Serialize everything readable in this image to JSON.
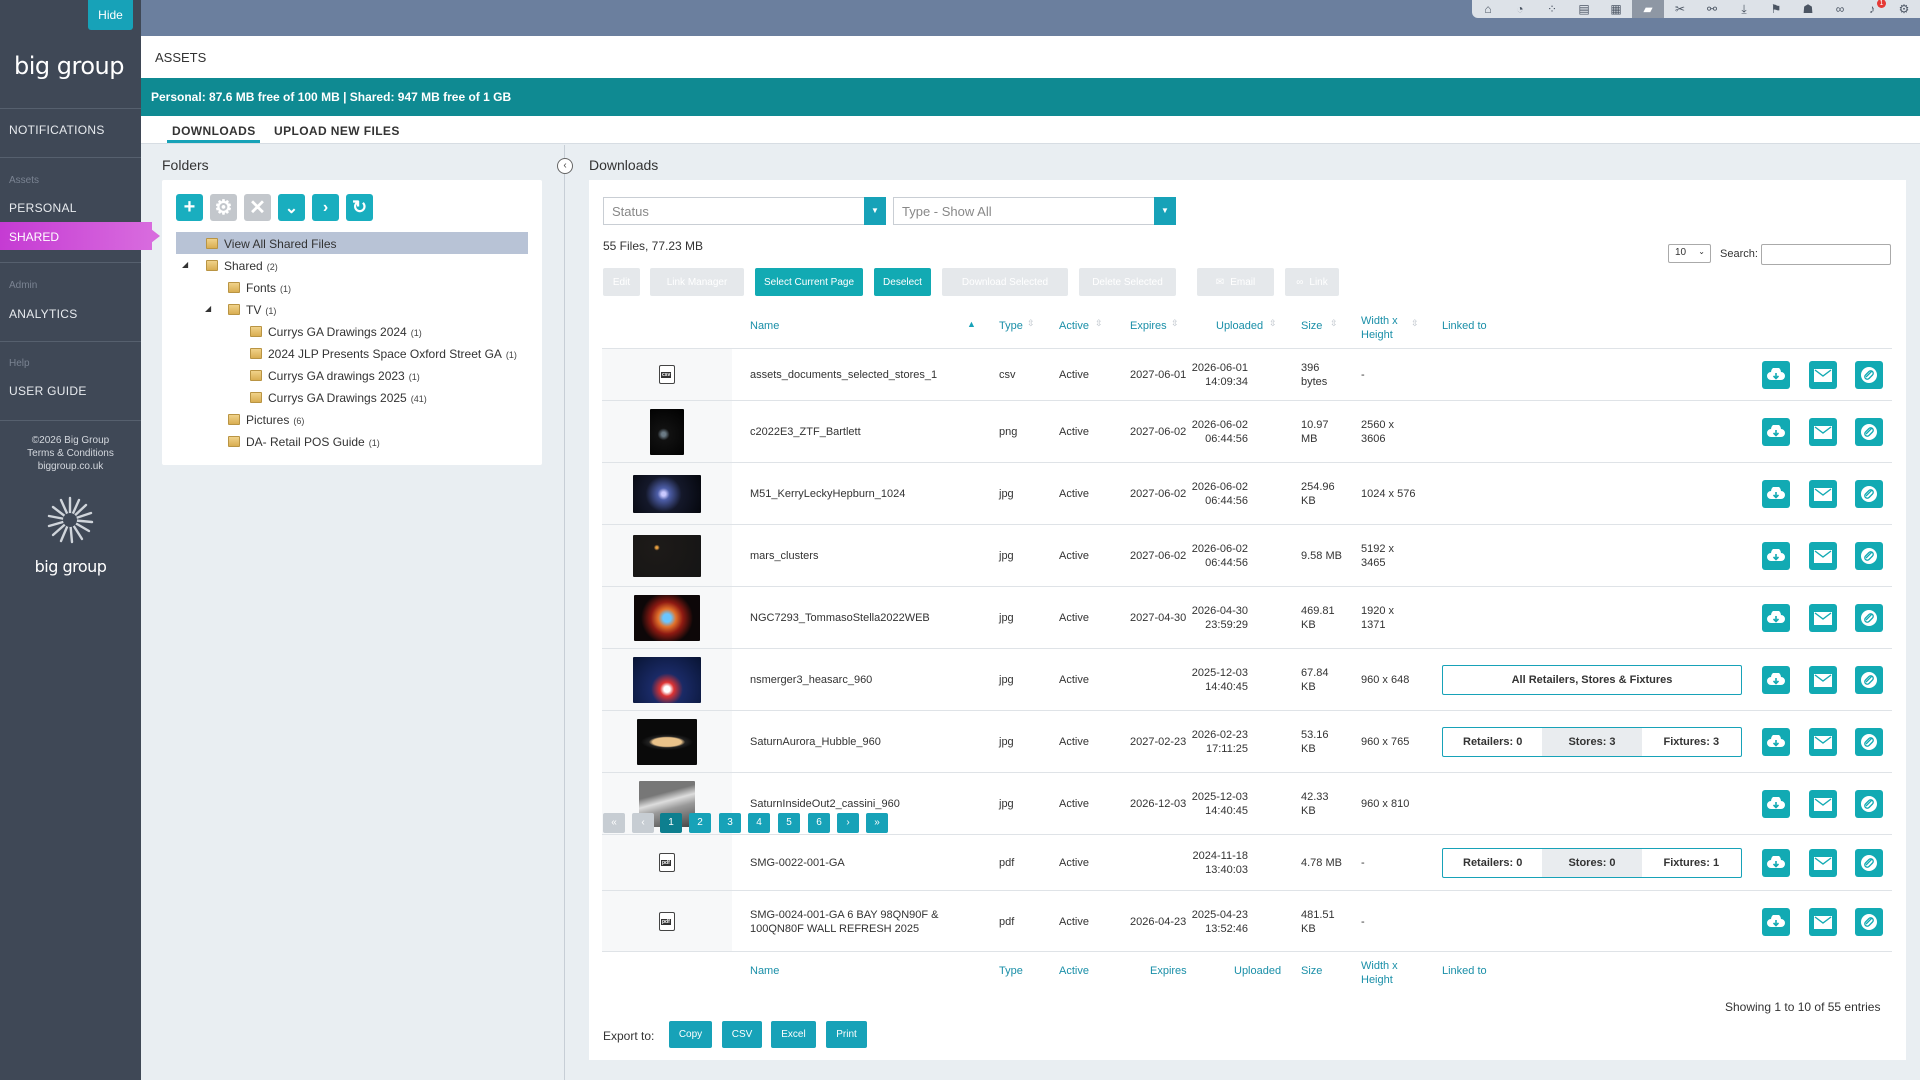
{
  "sidebar": {
    "hide_label": "Hide",
    "logo_text": "big group",
    "items": {
      "notifications": "NOTIFICATIONS",
      "assets_heading": "Assets",
      "personal": "PERSONAL",
      "shared": "SHARED",
      "admin_heading": "Admin",
      "analytics": "ANALYTICS",
      "help_heading": "Help",
      "user_guide": "USER GUIDE"
    },
    "copyright": [
      "©2026 Big Group",
      "Terms & Conditions",
      "biggroup.co.uk"
    ],
    "logo_bottom": "big group"
  },
  "topbar": {
    "icons": [
      "home-icon",
      "dashboard-icon",
      "network-icon",
      "document-icon",
      "grid-icon",
      "folder-icon",
      "tools-icon",
      "sitemap-icon",
      "download-icon",
      "megaphone-icon",
      "robot-icon",
      "link-icon",
      "bell-icon",
      "gear-icon"
    ],
    "active": "folder-icon",
    "notification_badge": "1"
  },
  "header": {
    "title": "ASSETS"
  },
  "quota": "Personal: 87.6 MB free of 100 MB | Shared: 947 MB free of 1 GB",
  "tabs": {
    "downloads": "DOWNLOADS",
    "upload": "UPLOAD NEW FILES"
  },
  "folders": {
    "title": "Folders",
    "tree": [
      {
        "label": "View All Shared Files",
        "count": ""
      },
      {
        "label": "Shared",
        "count": "(2)"
      },
      {
        "label": "Fonts",
        "count": "(1)"
      },
      {
        "label": "TV",
        "count": "(1)"
      },
      {
        "label": "Currys GA Drawings 2024",
        "count": "(1)"
      },
      {
        "label": "2024 JLP Presents Space Oxford Street GA",
        "count": "(1)"
      },
      {
        "label": "Currys GA drawings 2023",
        "count": "(1)"
      },
      {
        "label": "Currys GA Drawings 2025",
        "count": "(41)"
      },
      {
        "label": "Pictures",
        "count": "(6)"
      },
      {
        "label": "DA- Retail POS Guide",
        "count": "(1)"
      }
    ]
  },
  "downloads": {
    "title": "Downloads",
    "status_placeholder": "Status",
    "type_filter": "Type - Show All",
    "summary": "55 Files, 77.23 MB",
    "page_length": "10",
    "search_label": "Search:",
    "buttons": {
      "edit": "Edit",
      "link_manager": "Link Manager",
      "select_page": "Select Current Page",
      "deselect": "Deselect",
      "download_selected": "Download Selected",
      "delete_selected": "Delete Selected",
      "email": "Email",
      "link": "Link"
    },
    "columns": {
      "name": "Name",
      "type": "Type",
      "active": "Active",
      "expires": "Expires",
      "uploaded": "Uploaded",
      "size": "Size",
      "dims": "Width x Height",
      "linked": "Linked to"
    },
    "rows": [
      {
        "name": "assets_documents_selected_stores_1",
        "type": "csv",
        "active": "Active",
        "expires": "2027-06-01",
        "uploaded_date": "2026-06-01",
        "uploaded_time": "14:09:34",
        "size1": "396",
        "size2": "bytes",
        "dims1": "-",
        "dims2": ""
      },
      {
        "name": "c2022E3_ZTF_Bartlett",
        "type": "png",
        "active": "Active",
        "expires": "2027-06-02",
        "uploaded_date": "2026-06-02",
        "uploaded_time": "06:44:56",
        "size1": "10.97",
        "size2": "MB",
        "dims1": "2560 x",
        "dims2": "3606"
      },
      {
        "name": "M51_KerryLeckyHepburn_1024",
        "type": "jpg",
        "active": "Active",
        "expires": "2027-06-02",
        "uploaded_date": "2026-06-02",
        "uploaded_time": "06:44:56",
        "size1": "254.96",
        "size2": "KB",
        "dims1": "1024 x 576",
        "dims2": ""
      },
      {
        "name": "mars_clusters",
        "type": "jpg",
        "active": "Active",
        "expires": "2027-06-02",
        "uploaded_date": "2026-06-02",
        "uploaded_time": "06:44:56",
        "size1": "9.58 MB",
        "size2": "",
        "dims1": "5192 x",
        "dims2": "3465"
      },
      {
        "name": "NGC7293_TommasoStella2022WEB",
        "type": "jpg",
        "active": "Active",
        "expires": "2027-04-30",
        "uploaded_date": "2026-04-30",
        "uploaded_time": "23:59:29",
        "size1": "469.81",
        "size2": "KB",
        "dims1": "1920 x",
        "dims2": "1371"
      },
      {
        "name": "nsmerger3_heasarc_960",
        "type": "jpg",
        "active": "Active",
        "expires": "",
        "uploaded_date": "2025-12-03",
        "uploaded_time": "14:40:45",
        "size1": "67.84",
        "size2": "KB",
        "dims1": "960 x 648",
        "dims2": "",
        "linked": "All Retailers, Stores & Fixtures"
      },
      {
        "name": "SaturnAurora_Hubble_960",
        "type": "jpg",
        "active": "Active",
        "expires": "2027-02-23",
        "uploaded_date": "2026-02-23",
        "uploaded_time": "17:11:25",
        "size1": "53.16",
        "size2": "KB",
        "dims1": "960 x 765",
        "dims2": "",
        "retailers": "Retailers: 0",
        "stores": "Stores: 3",
        "fixtures": "Fixtures: 3"
      },
      {
        "name": "SaturnInsideOut2_cassini_960",
        "type": "jpg",
        "active": "Active",
        "expires": "2026-12-03",
        "uploaded_date": "2025-12-03",
        "uploaded_time": "14:40:45",
        "size1": "42.33",
        "size2": "KB",
        "dims1": "960 x 810",
        "dims2": ""
      },
      {
        "name": "SMG-0022-001-GA",
        "type": "pdf",
        "active": "Active",
        "expires": "",
        "uploaded_date": "2024-11-18",
        "uploaded_time": "13:40:03",
        "size1": "4.78 MB",
        "size2": "",
        "dims1": "-",
        "dims2": "",
        "retailers": "Retailers: 0",
        "stores": "Stores: 0",
        "fixtures": "Fixtures: 1"
      },
      {
        "name": "SMG-0024-001-GA 6 BAY 98QN90F &",
        "name2": "100QN80F WALL REFRESH 2025",
        "type": "pdf",
        "active": "Active",
        "expires": "2026-04-23",
        "uploaded_date": "2025-04-23",
        "uploaded_time": "13:52:46",
        "size1": "481.51",
        "size2": "KB",
        "dims1": "-",
        "dims2": ""
      }
    ],
    "pagination": [
      "«",
      "‹",
      "1",
      "2",
      "3",
      "4",
      "5",
      "6",
      "›",
      "»"
    ],
    "showing": "Showing 1 to 10 of 55 entries",
    "export_label": "Export to:",
    "export": [
      "Copy",
      "CSV",
      "Excel",
      "Print"
    ]
  },
  "colors": {
    "accent": "#17a2b8",
    "quota_bar": "#0f8a92",
    "sidebar": "#3f4856",
    "shared_highlight": "#c53bd3"
  }
}
